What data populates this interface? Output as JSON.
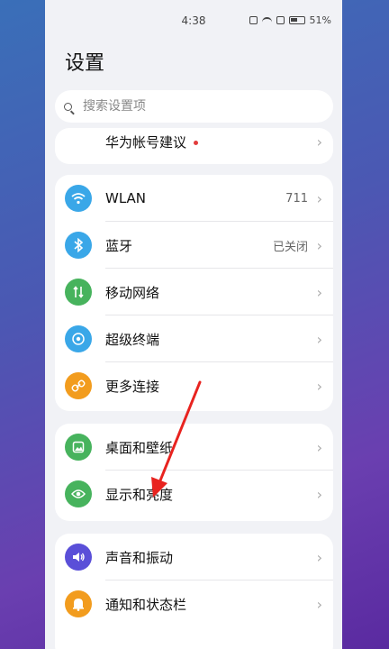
{
  "status": {
    "time": "4:38",
    "battery": "51%"
  },
  "page": {
    "title": "设置"
  },
  "search": {
    "placeholder": "搜索设置项"
  },
  "account": {
    "label": "华为帐号建议"
  },
  "connectivity": {
    "items": [
      {
        "label": "WLAN",
        "value": "711",
        "icon": "wifi-icon",
        "color": "#3aa7e8"
      },
      {
        "label": "蓝牙",
        "value": "已关闭",
        "icon": "bluetooth-icon",
        "color": "#3aa7e8"
      },
      {
        "label": "移动网络",
        "value": "",
        "icon": "mobile-network-icon",
        "color": "#47b35d"
      },
      {
        "label": "超级终端",
        "value": "",
        "icon": "super-device-icon",
        "color": "#3aa7e8"
      },
      {
        "label": "更多连接",
        "value": "",
        "icon": "link-icon",
        "color": "#f29c1e"
      }
    ]
  },
  "display": {
    "items": [
      {
        "label": "桌面和壁纸",
        "icon": "wallpaper-icon",
        "color": "#47b35d"
      },
      {
        "label": "显示和亮度",
        "icon": "eye-icon",
        "color": "#47b35d"
      }
    ]
  },
  "sound": {
    "items": [
      {
        "label": "声音和振动",
        "icon": "speaker-icon",
        "color": "#5a4fd8"
      },
      {
        "label": "通知和状态栏",
        "icon": "bell-icon",
        "color": "#f29c1e"
      }
    ]
  }
}
